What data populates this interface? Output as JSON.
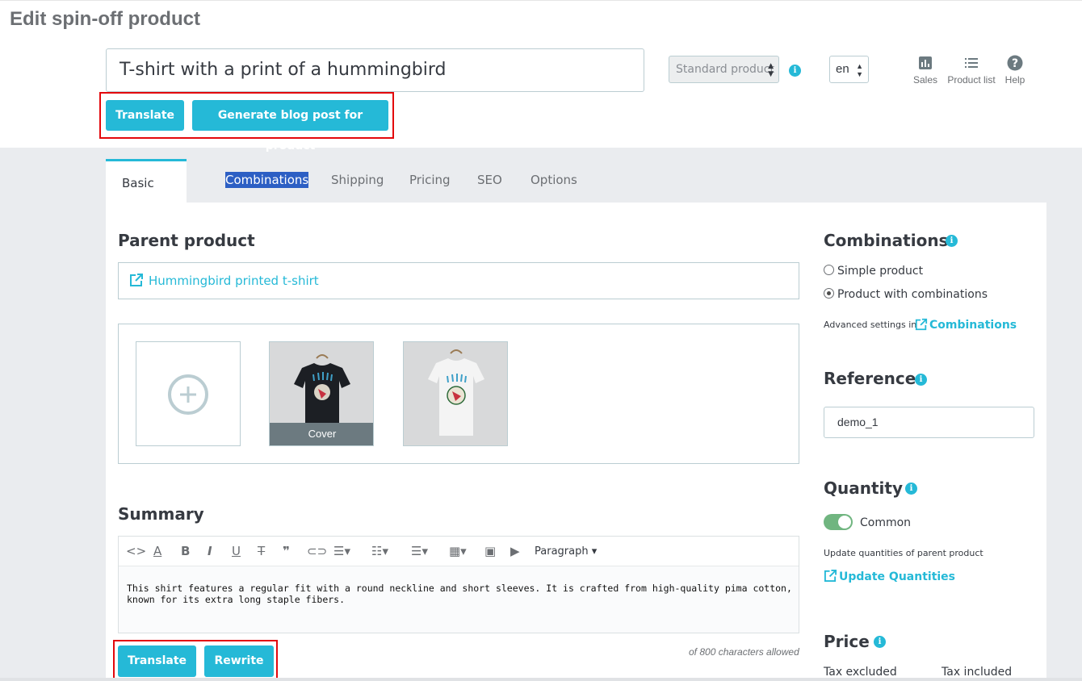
{
  "page": {
    "title": "Edit spin-off product"
  },
  "header": {
    "product_name": "T-shirt with a print of a hummingbird",
    "translate_label": "Translate",
    "blog_label": "Generate blog post for product",
    "product_type": "Standard product",
    "language": "en",
    "tools": {
      "sales": "Sales",
      "product_list": "Product list",
      "help": "Help"
    }
  },
  "tabs": [
    "Basic settings",
    "Combinations",
    "Shipping",
    "Pricing",
    "SEO",
    "Options"
  ],
  "parent": {
    "heading": "Parent product",
    "link": "Hummingbird printed t-shirt"
  },
  "images": {
    "cover_label": "Cover"
  },
  "summary": {
    "heading": "Summary",
    "format_label": "Paragraph",
    "text": "This shirt features a regular fit with a round neckline and short sleeves. It is crafted from high-quality pima cotton, known for its extra long staple fibers.",
    "chars_note": "of 800 characters allowed",
    "translate_label": "Translate",
    "rewrite_label": "Rewrite"
  },
  "sidebar": {
    "combinations_heading": "Combinations",
    "simple_label": "Simple product",
    "with_comb_label": "Product with combinations",
    "advanced_text": "Advanced settings in",
    "advanced_link": "Combinations",
    "reference_heading": "Reference",
    "reference_value": "demo_1",
    "quantity_heading": "Quantity",
    "common_label": "Common",
    "update_text": "Update quantities of parent product",
    "update_link": "Update Quantities",
    "price_heading": "Price",
    "tax_excluded": "Tax excluded",
    "tax_included": "Tax included"
  },
  "colors": {
    "accent": "#25b9d7",
    "highlight": "#e3080c",
    "switch_on": "#70b580"
  }
}
